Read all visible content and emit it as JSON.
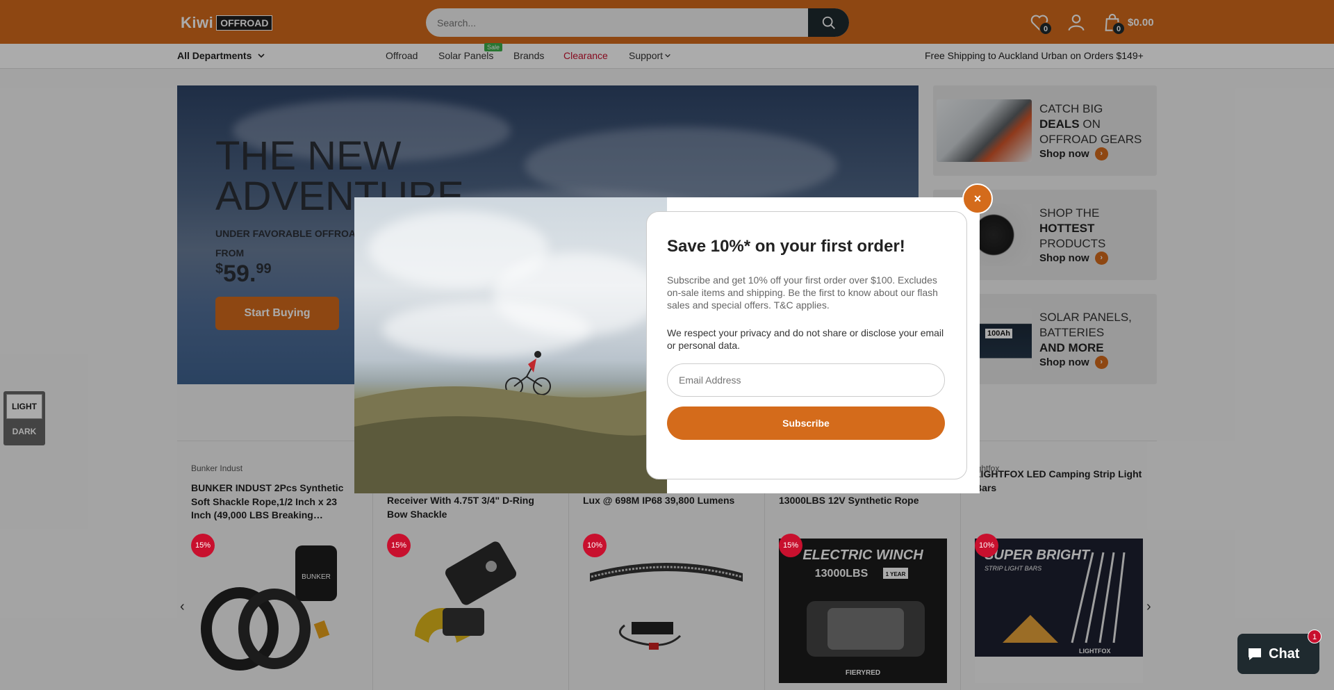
{
  "header": {
    "logo_word": "Kiwi",
    "logo_badge": "OFFROAD",
    "search_placeholder": "Search...",
    "wishlist_count": "0",
    "cart_count": "0",
    "cart_total": "$0.00",
    "brand_color": "#d46b1b"
  },
  "nav": {
    "departments": "All Departments",
    "links": [
      "Offroad",
      "Solar Panels",
      "Brands",
      "Clearance",
      "Support"
    ],
    "sale_tag": "Sale",
    "clearance_color": "#c8102e",
    "shipping": "Free Shipping to Auckland Urban on Orders $149+"
  },
  "hero": {
    "title": "THE NEW ADVENTURE",
    "subtitle": "UNDER FAVORABLE OFFROA",
    "from": "FROM",
    "price_currency": "$",
    "price_main": "59.",
    "price_cents": "99",
    "button": "Start Buying"
  },
  "promos": [
    {
      "line1": "CATCH BIG",
      "bold": "DEALS",
      "line2": " ON",
      "line3": "OFFROAD GEARS",
      "shop": "Shop now"
    },
    {
      "line1": "SHOP THE",
      "bold": "HOTTEST",
      "line2": "",
      "line3": "PRODUCTS",
      "shop": "Shop now"
    },
    {
      "line1": "SOLAR PANELS,",
      "line2": "BATTERIES",
      "bold": "AND MORE",
      "shop": "Shop now"
    }
  ],
  "mode": {
    "light": "LIGHT",
    "dark": "DARK"
  },
  "products": [
    {
      "vendor": "Bunker Indust",
      "title": "BUNKER INDUST 2Pcs Synthetic Soft Shackle Rope,1/2 Inch x 23 Inch (49,000 LBS Breaking…",
      "discount": "15%"
    },
    {
      "vendor": "",
      "title": "Receiver With 4.75T 3/4\" D-Ring Bow Shackle",
      "discount": "15%"
    },
    {
      "vendor": "",
      "title": "Lux @ 698M IP68 39,800 Lumens",
      "discount": "10%"
    },
    {
      "vendor": "",
      "title": "13000LBS 12V Synthetic Rope",
      "discount": "15%"
    },
    {
      "vendor": "ightfox",
      "title": "LIGHTFOX LED Camping Strip Light Bars",
      "discount": "10%"
    }
  ],
  "product_images": {
    "winch_title": "ELECTRIC WINCH",
    "winch_sub": "13000LBS",
    "winch_badge": "1 YEAR",
    "winch_brand": "FIERYRED",
    "strip_title": "SUPER BRIGHT",
    "strip_sub": "STRIP LIGHT BARS",
    "strip_brand": "LIGHTFOX",
    "bag_brand": "BUNKER",
    "battery_label": "100Ah"
  },
  "popup": {
    "title": "Save 10%* on your first order!",
    "p1": "Subscribe and get 10% off your first order over $100. Excludes on-sale items and shipping. Be the first to know about our flash sales and special offers. T&C applies.",
    "p2": "We respect your privacy and do not share or disclose your email or personal data.",
    "email_placeholder": "Email Address",
    "subscribe": "Subscribe",
    "close": "×"
  },
  "chat": {
    "label": "Chat",
    "unread": "1"
  }
}
